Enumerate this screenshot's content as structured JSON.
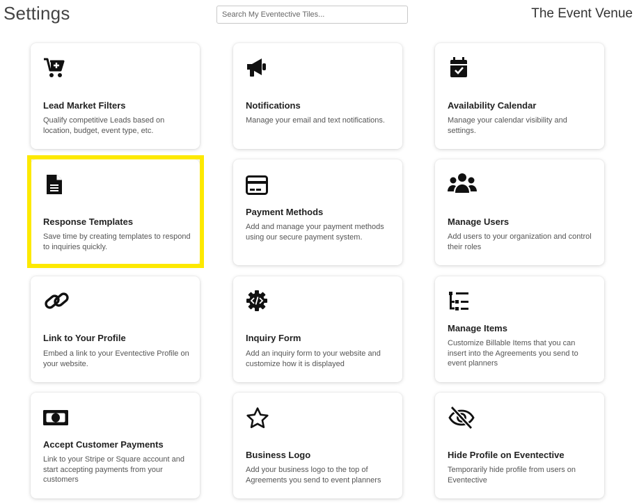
{
  "header": {
    "title": "Settings",
    "search_placeholder": "Search My Eventective Tiles...",
    "venue_name": "The Event Venue"
  },
  "tiles": [
    {
      "title": "Lead Market Filters",
      "desc": "Qualify competitive Leads based on location, budget, event type, etc.",
      "icon": "cart-plus-icon"
    },
    {
      "title": "Notifications",
      "desc": "Manage your email and text notifications.",
      "icon": "megaphone-icon"
    },
    {
      "title": "Availability Calendar",
      "desc": "Manage your calendar visibility and settings.",
      "icon": "calendar-check-icon"
    },
    {
      "title": "Response Templates",
      "desc": "Save time by creating templates to respond to inquiries quickly.",
      "icon": "document-icon",
      "highlighted": true
    },
    {
      "title": "Payment Methods",
      "desc": "Add and manage your payment methods using our secure payment system.",
      "icon": "credit-card-icon"
    },
    {
      "title": "Manage Users",
      "desc": "Add users to your organization and control their roles",
      "icon": "users-icon"
    },
    {
      "title": "Link to Your Profile",
      "desc": "Embed a link to your Eventective Profile on your website.",
      "icon": "link-icon"
    },
    {
      "title": "Inquiry Form",
      "desc": "Add an inquiry form to your website and customize how it is displayed",
      "icon": "code-gear-icon"
    },
    {
      "title": "Manage Items",
      "desc": "Customize Billable Items that you can insert into the Agreements you send to event planners",
      "icon": "tree-list-icon"
    },
    {
      "title": "Accept Customer Payments",
      "desc": "Link to your Stripe or Square account and start accepting payments from your customers",
      "icon": "money-bill-icon"
    },
    {
      "title": "Business Logo",
      "desc": "Add your business logo to the top of Agreements you send to event planners",
      "icon": "star-icon"
    },
    {
      "title": "Hide Profile on Eventective",
      "desc": "Temporarily hide profile from users on Eventective",
      "icon": "eye-slash-icon"
    }
  ],
  "colors": {
    "highlight": "#fde900",
    "icon": "#111111"
  }
}
